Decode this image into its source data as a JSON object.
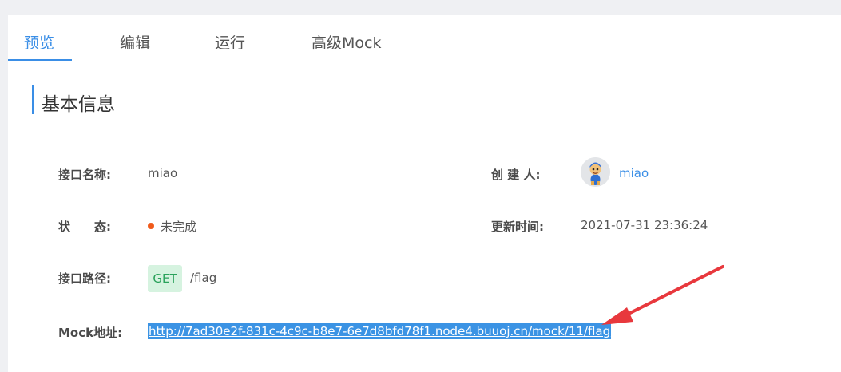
{
  "tabs": [
    {
      "label": "预览",
      "active": true
    },
    {
      "label": "编辑",
      "active": false
    },
    {
      "label": "运行",
      "active": false
    },
    {
      "label": "高级Mock",
      "active": false
    }
  ],
  "section": {
    "title": "基本信息"
  },
  "fields": {
    "name_label": "接口名称:",
    "name_value": "miao",
    "creator_label": "创 建 人:",
    "creator_value": "miao",
    "status_label": "状　　态:",
    "status_value": "未完成",
    "updated_label": "更新时间:",
    "updated_value": "2021-07-31 23:36:24",
    "path_label": "接口路径:",
    "method": "GET",
    "path_value": "/flag",
    "mock_label": "Mock地址:",
    "mock_url": "http://7ad30e2f-831c-4c9c-b8e7-6e7d8bfd78f1.node4.buuoj.cn/mock/11/flag"
  },
  "colors": {
    "accent": "#3a8ee6",
    "status_incomplete": "#f05a1a",
    "method_get_bg": "#d6f3e0",
    "method_get_text": "#2aa25b",
    "selection_bg": "#3b93e4",
    "annotation_arrow": "#e8383d"
  },
  "icons": {
    "avatar": "user-avatar-icon",
    "annotation": "red-arrow-icon"
  }
}
